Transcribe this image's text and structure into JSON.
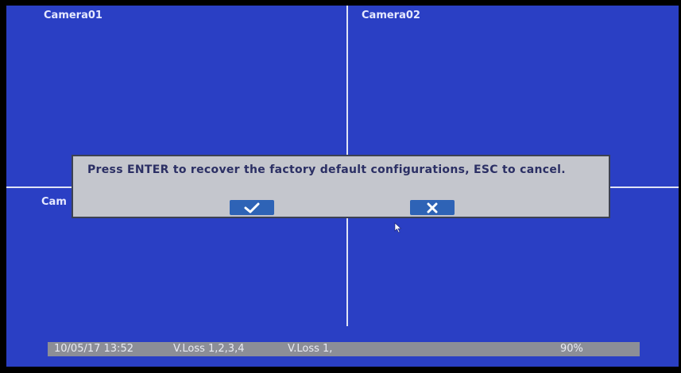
{
  "cameras": [
    {
      "label": "Camera01"
    },
    {
      "label": "Camera02"
    },
    {
      "label": "Cam"
    }
  ],
  "dialog": {
    "message": "Press ENTER to recover the factory default configurations, ESC to cancel.",
    "confirm_icon": "checkmark-icon",
    "cancel_icon": "x-icon"
  },
  "status_bar": {
    "datetime": "10/05/17 13:52",
    "vloss_primary": "V.Loss 1,2,3,4",
    "vloss_secondary": "V.Loss 1,",
    "percent": "90%"
  },
  "colors": {
    "screen_bg": "#2a3fc4",
    "grid_line": "#dfe3f5",
    "dialog_bg": "#c4c6cd",
    "dialog_text": "#2b2f64",
    "button_bg": "#2e63b6",
    "status_bg": "#8c8e97"
  }
}
